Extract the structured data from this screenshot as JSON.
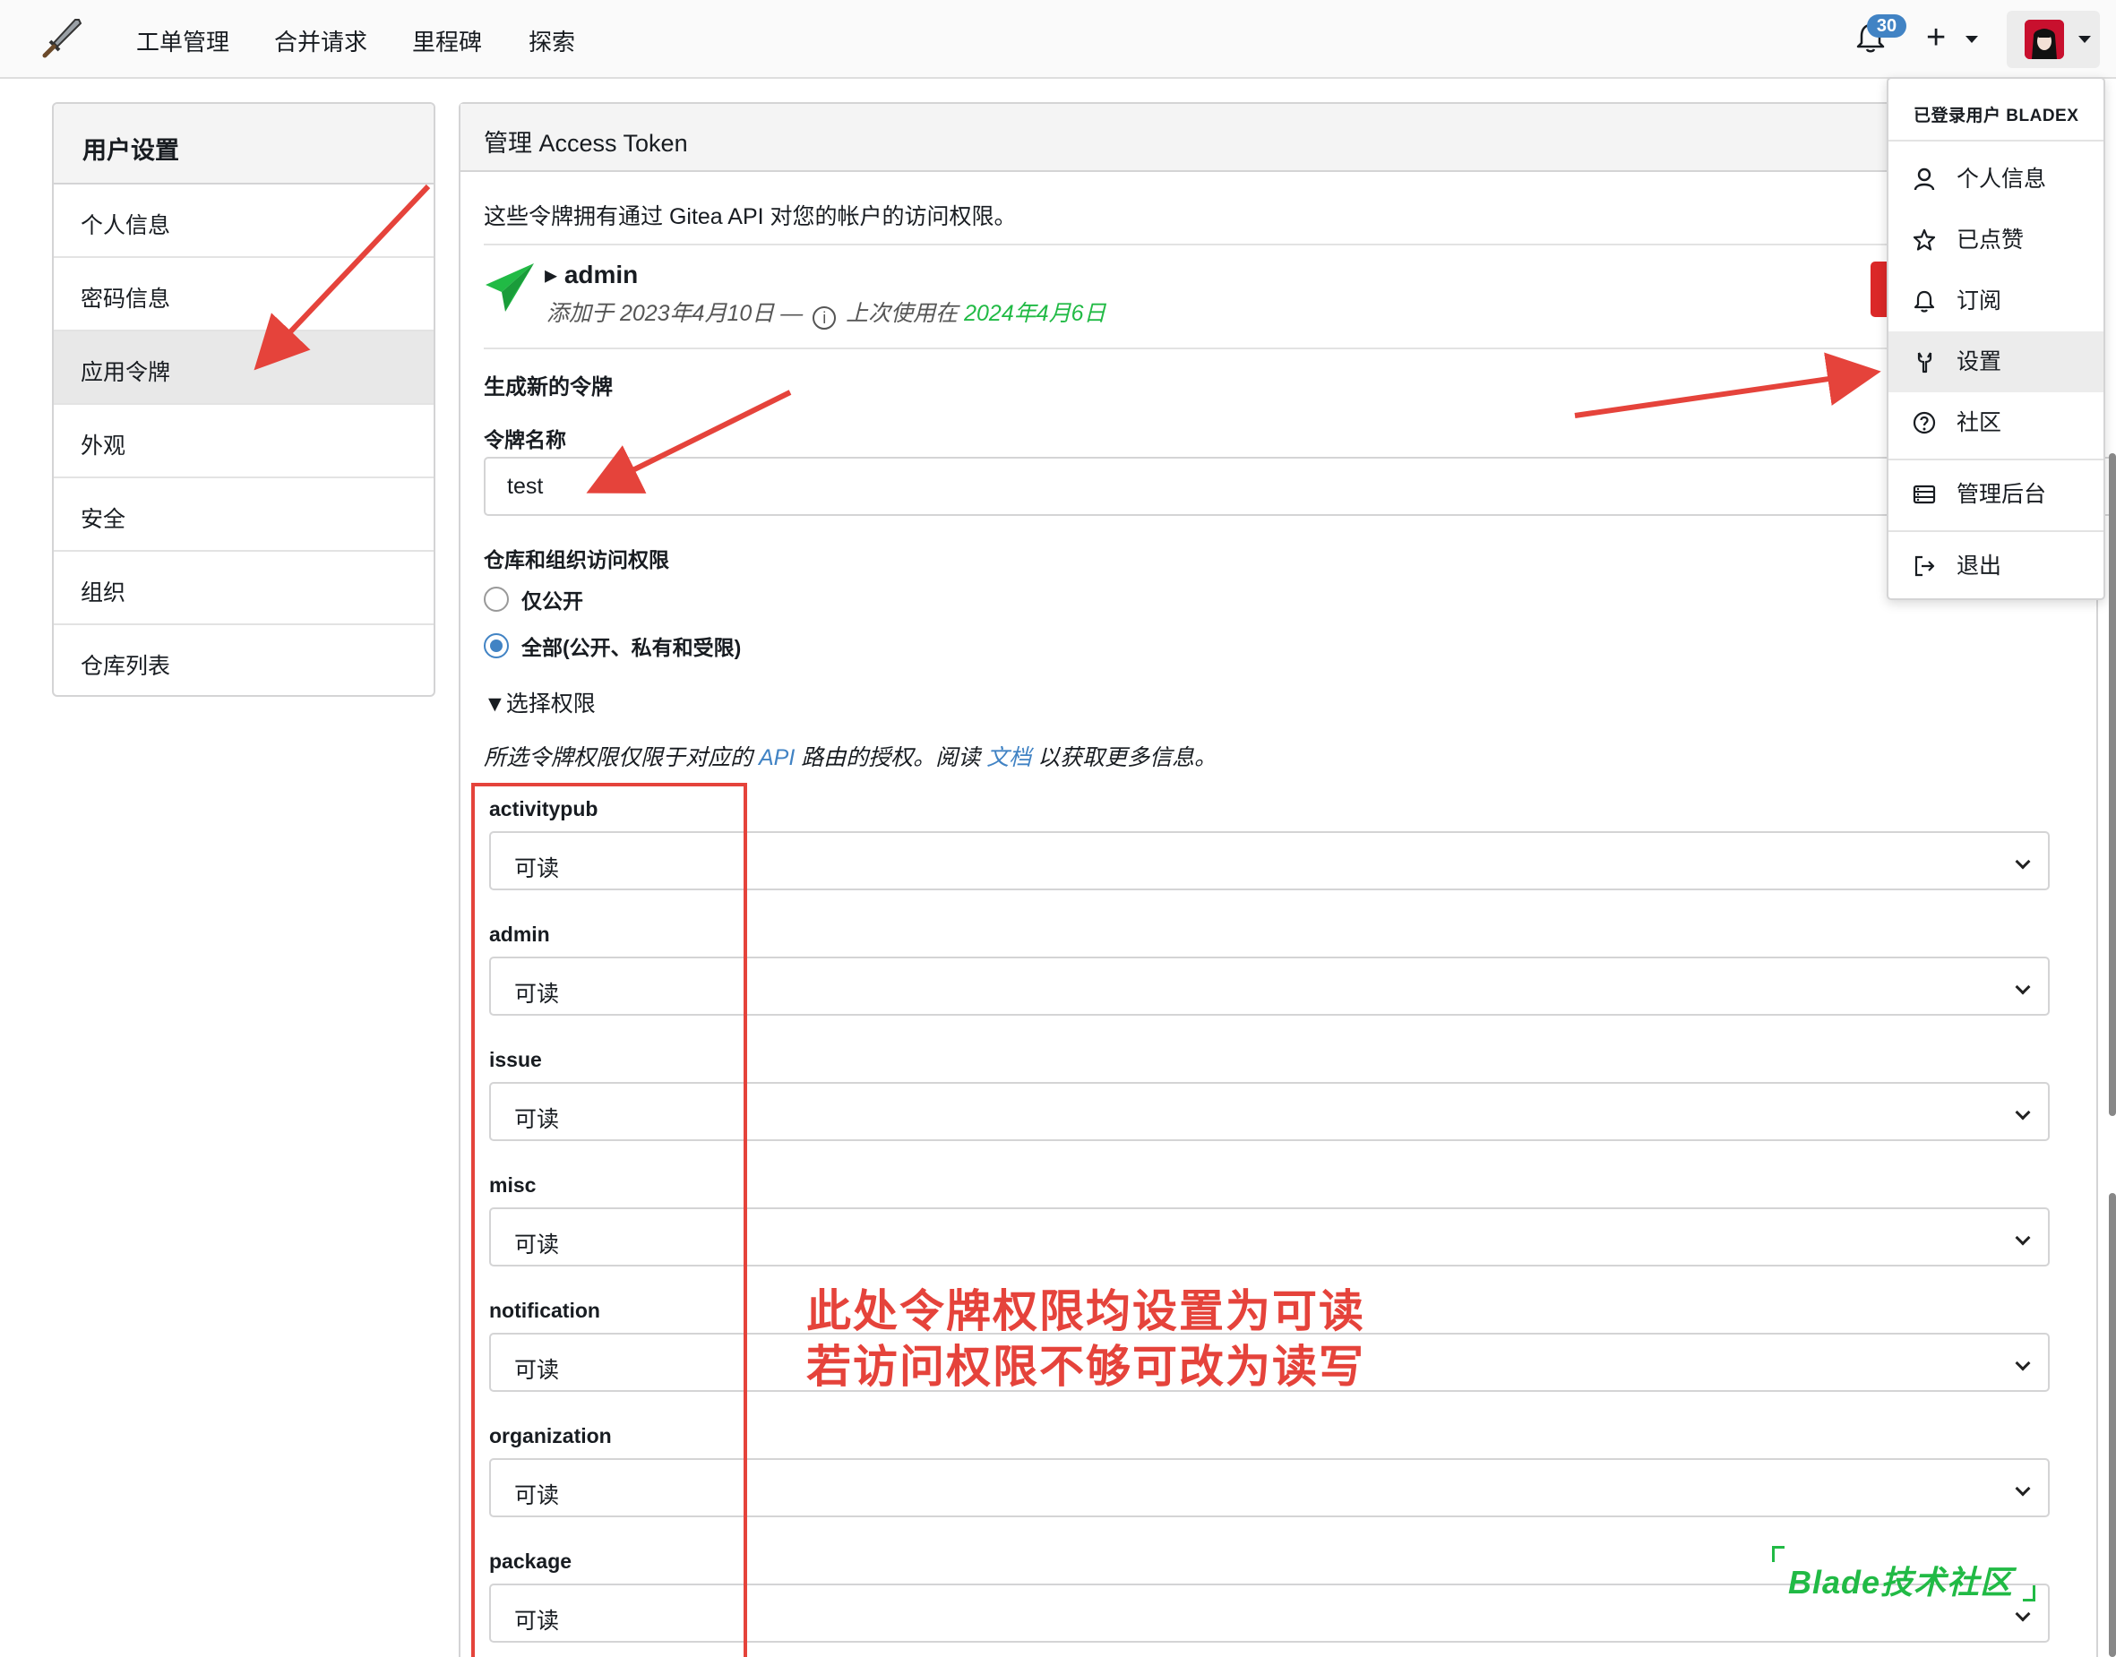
{
  "navbar": {
    "items": [
      "工单管理",
      "合并请求",
      "里程碑",
      "探索"
    ],
    "notification_count": "30",
    "plus": "+"
  },
  "sidebar": {
    "title": "用户设置",
    "items": [
      "个人信息",
      "密码信息",
      "应用令牌",
      "外观",
      "安全",
      "组织",
      "仓库列表"
    ],
    "active_index": 2
  },
  "main": {
    "header": "管理 Access Token",
    "description": "这些令牌拥有通过 Gitea API 对您的帐户的访问权限。",
    "token": {
      "name": "▸ admin",
      "added": "添加于 2023年4月10日 —",
      "last_used_label": "上次使用在",
      "last_used_date": "2024年4月6日"
    },
    "generate_title": "生成新的令牌",
    "token_name_label": "令牌名称",
    "token_name_value": "test",
    "access_label": "仓库和组织访问权限",
    "radio_public": "仅公开",
    "radio_all": "全部(公开、私有和受限)",
    "select_perm_summary": "▼选择权限",
    "perm_desc_prefix": "所选令牌权限仅限于对应的",
    "perm_desc_api": "API",
    "perm_desc_mid": "路由的授权。阅读",
    "perm_desc_docs": "文档",
    "perm_desc_suffix": "以获取更多信息。",
    "permissions": [
      {
        "name": "activitypub",
        "value": "可读"
      },
      {
        "name": "admin",
        "value": "可读"
      },
      {
        "name": "issue",
        "value": "可读"
      },
      {
        "name": "misc",
        "value": "可读"
      },
      {
        "name": "notification",
        "value": "可读"
      },
      {
        "name": "organization",
        "value": "可读"
      },
      {
        "name": "package",
        "value": "可读"
      }
    ]
  },
  "menu": {
    "header": "已登录用户 BLADEX",
    "items": [
      {
        "label": "个人信息",
        "icon": "person-icon"
      },
      {
        "label": "已点赞",
        "icon": "star-icon"
      },
      {
        "label": "订阅",
        "icon": "bell-icon"
      },
      {
        "label": "设置",
        "icon": "tools-icon"
      },
      {
        "label": "社区",
        "icon": "question-icon"
      },
      {
        "label": "管理后台",
        "icon": "server-icon"
      },
      {
        "label": "退出",
        "icon": "sign-out-icon"
      }
    ],
    "active_index": 3
  },
  "annotation": {
    "line1": "此处令牌权限均设置为可读",
    "line2": "若访问权限不够可改为读写",
    "color": "#e5433b"
  },
  "watermark": "Blade技术社区",
  "colors": {
    "accent": "#4183c4",
    "green": "#21ba45",
    "danger": "#db2828"
  }
}
